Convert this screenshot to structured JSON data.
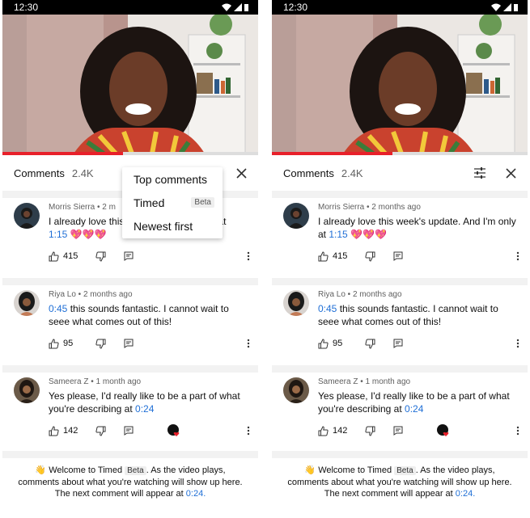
{
  "status_time": "12:30",
  "comments_title": "Comments",
  "comments_count": "2.4K",
  "sort_menu": {
    "items": [
      "Top comments",
      "Timed",
      "Newest first"
    ],
    "beta_label": "Beta"
  },
  "comments": [
    {
      "author_meta": "Morris Sierra • 2 months ago",
      "author_meta_truncated": "Morris Sierra • 2 m",
      "text_left_line1_truncated": "I already love this",
      "text_truncated_tail": "nly at",
      "text": "I already love this week's update. And I'm only at",
      "timestamp": "1:15",
      "emoji": "💖💖💖",
      "likes": "415"
    },
    {
      "author_meta": "Riya Lo • 2 months ago",
      "timestamp": "0:45",
      "text": "this sounds fantastic. I cannot wait to seee what comes out of this!",
      "likes": "95"
    },
    {
      "author_meta": "Sameera Z • 1 month ago",
      "text": "Yes please, I'd really like to be a part of what you're describing at",
      "timestamp": "0:24",
      "likes": "142"
    }
  ],
  "welcome": {
    "emoji": "👋",
    "line1_a": "Welcome to Timed",
    "beta": "Beta",
    "line1_b": ". As the video plays,",
    "line2": "comments about what you're watching will show up here.",
    "line3": "The next comment will appear at",
    "timestamp": "0:24."
  },
  "icons": {
    "like": "thumbs-up-icon",
    "dislike": "thumbs-down-icon",
    "reply": "reply-icon",
    "more": "more-vertical-icon",
    "close": "close-icon",
    "filter": "filter-icon"
  },
  "colors": {
    "progress": "#e8202a",
    "link": "#1f6fd6"
  },
  "video_progress": 0.47
}
